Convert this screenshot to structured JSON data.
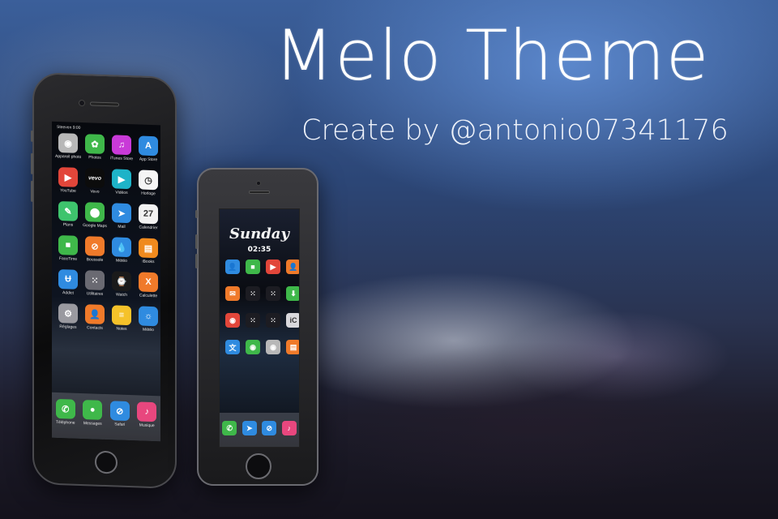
{
  "title": "Melo Theme",
  "subtitle": "Create by @antonio07341176",
  "big_phone": {
    "status": "Steeven 9:00",
    "apps": [
      {
        "label": "Appareil photo",
        "icon": "camera-icon",
        "color": "#b8b8b8",
        "glyph": "◉"
      },
      {
        "label": "Photos",
        "icon": "flower-icon",
        "color": "#3fb84a",
        "glyph": "✿"
      },
      {
        "label": "iTunes Store",
        "icon": "music-icon",
        "color": "#c93ad8",
        "glyph": "♫"
      },
      {
        "label": "App Store",
        "icon": "appstore-icon",
        "color": "#2f8be0",
        "glyph": "A"
      },
      {
        "label": "YouTube",
        "icon": "play-icon",
        "color": "#e2463a",
        "glyph": "▶"
      },
      {
        "label": "Vevo",
        "icon": "vevo-icon",
        "color": "#0c0c0c",
        "glyph": "vevo"
      },
      {
        "label": "Vidéos",
        "icon": "video-icon",
        "color": "#1eb3c8",
        "glyph": "▶"
      },
      {
        "label": "Horloge",
        "icon": "clock-icon",
        "color": "#f5f5f5",
        "glyph": "◷"
      },
      {
        "label": "Plans",
        "icon": "map-icon",
        "color": "#3ec46d",
        "glyph": "✎"
      },
      {
        "label": "Google Maps",
        "icon": "pin-icon",
        "color": "#3fb84a",
        "glyph": "⬤"
      },
      {
        "label": "Mail",
        "icon": "send-icon",
        "color": "#2f8be0",
        "glyph": "➤"
      },
      {
        "label": "Calendrier",
        "icon": "calendar-icon",
        "color": "#f2f2f2",
        "glyph": "27"
      },
      {
        "label": "FaceTime",
        "icon": "facetime-icon",
        "color": "#3fb84a",
        "glyph": "■"
      },
      {
        "label": "Boussole",
        "icon": "compass-icon",
        "color": "#f07a2a",
        "glyph": "⊘"
      },
      {
        "label": "Météo",
        "icon": "drop-icon",
        "color": "#2f8be0",
        "glyph": "💧"
      },
      {
        "label": "iBooks",
        "icon": "book-icon",
        "color": "#f08a1e",
        "glyph": "▤"
      },
      {
        "label": "Addict",
        "icon": "addict-icon",
        "color": "#2f8be0",
        "glyph": "Ʉ"
      },
      {
        "label": "Utilitaires",
        "icon": "folder-icon",
        "color": "#6a6a72",
        "glyph": "⁙"
      },
      {
        "label": "Watch",
        "icon": "watch-icon",
        "color": "#1a1a1a",
        "glyph": "⌚"
      },
      {
        "label": "Calculette",
        "icon": "calculator-icon",
        "color": "#f07a2a",
        "glyph": "X"
      },
      {
        "label": "Réglages",
        "icon": "gear-icon",
        "color": "#9a9aa0",
        "glyph": "⚙"
      },
      {
        "label": "Contacts",
        "icon": "contacts-icon",
        "color": "#f07a2a",
        "glyph": "👤"
      },
      {
        "label": "Notes",
        "icon": "notes-icon",
        "color": "#f5c22a",
        "glyph": "≡"
      },
      {
        "label": "Météo",
        "icon": "weather-icon",
        "color": "#2f8be0",
        "glyph": "☼"
      }
    ],
    "dock": [
      {
        "label": "Téléphone",
        "icon": "phone-icon",
        "color": "#3fb84a",
        "glyph": "✆"
      },
      {
        "label": "Messages",
        "icon": "messages-icon",
        "color": "#3fb84a",
        "glyph": "●"
      },
      {
        "label": "Safari",
        "icon": "safari-icon",
        "color": "#2f8be0",
        "glyph": "⊘"
      },
      {
        "label": "Musique",
        "icon": "airpods-icon",
        "color": "#e8477e",
        "glyph": "♪"
      }
    ]
  },
  "small_phone": {
    "status": "Sunday",
    "time": "02:35",
    "apps": [
      {
        "icon": "contact-icon",
        "color": "#2f8be0",
        "glyph": "👤"
      },
      {
        "icon": "facetime-icon",
        "color": "#3fb84a",
        "glyph": "■"
      },
      {
        "icon": "video-icon",
        "color": "#e2463a",
        "glyph": "▶"
      },
      {
        "icon": "contacts-icon",
        "color": "#f07a2a",
        "glyph": "👤"
      },
      {
        "icon": "photo-icon",
        "color": "#f07a2a",
        "glyph": "✉"
      },
      {
        "icon": "folder-icon",
        "color": "#1c1c22",
        "glyph": "⁙"
      },
      {
        "icon": "folder-icon",
        "color": "#1c1c22",
        "glyph": "⁙"
      },
      {
        "icon": "download-icon",
        "color": "#3fb84a",
        "glyph": "⬇"
      },
      {
        "icon": "reddit-icon",
        "color": "#e2463a",
        "glyph": "◉"
      },
      {
        "icon": "folder-icon",
        "color": "#1c1c22",
        "glyph": "⁙"
      },
      {
        "icon": "folder-icon",
        "color": "#1c1c22",
        "glyph": "⁙"
      },
      {
        "icon": "ic-icon",
        "color": "#d8d8dc",
        "glyph": "iC"
      },
      {
        "icon": "translate-icon",
        "color": "#2f8be0",
        "glyph": "文"
      },
      {
        "icon": "spotify-icon",
        "color": "#3fb84a",
        "glyph": "◉"
      },
      {
        "icon": "camera-icon",
        "color": "#b8b8b8",
        "glyph": "◉"
      },
      {
        "icon": "books-icon",
        "color": "#f07a2a",
        "glyph": "▤"
      }
    ],
    "dock": [
      {
        "icon": "phone-icon",
        "color": "#3fb84a",
        "glyph": "✆"
      },
      {
        "icon": "telegram-icon",
        "color": "#2f8be0",
        "glyph": "➤"
      },
      {
        "icon": "safari-icon",
        "color": "#2f8be0",
        "glyph": "⊘"
      },
      {
        "icon": "airpods-icon",
        "color": "#e8477e",
        "glyph": "♪"
      }
    ]
  }
}
